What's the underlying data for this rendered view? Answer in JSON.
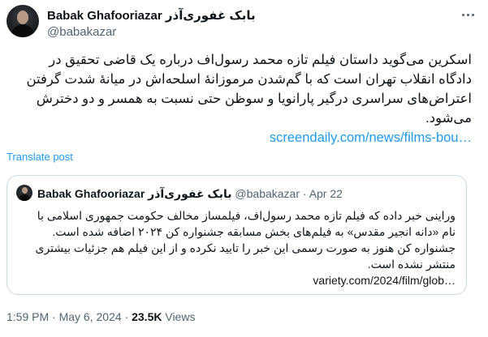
{
  "author": {
    "name": "Babak Ghafooriazar بابک غفوری‌آذر",
    "handle": "@babakazar"
  },
  "tweet": {
    "text": "اسکرین می‌گوید داستان فیلم تازه محمد رسول‌اف درباره یک قاضی تحقیق در دادگاه انقلاب تهران است که با گم‌شدن مرموزانهٔ اسلحه‌اش در میانهٔ شدت گرفتن اعتراض‌های سراسری درگیر پارانویا و سوظن حتی نسبت به همسر و دو دخترش می‌شود.",
    "link": "screendaily.com/news/films-bou…",
    "translate_label": "Translate post"
  },
  "quoted": {
    "name": "Babak Ghafooriazar بابک غفوری‌آذر",
    "handle": "@babakazar",
    "separator": "·",
    "date": "Apr 22",
    "text": "وراینی خبر داده که فیلم تازه محمد رسول‌اف، فیلمساز مخالف حکومت جمهوری اسلامی با نام «دانه انجیر مقدس» به فیلم‌های بخش مسابقه جشنواره کن ۲۰۲۴ اضافه شده است. جشنواره کن هنوز به صورت رسمی این خبر را تایید نکرده و از این فیلم هم جزئیات بیشتری منتشر نشده است.",
    "link": "variety.com/2024/film/glob…"
  },
  "meta": {
    "time": "1:59 PM",
    "date": "May 6, 2024",
    "separator": "·",
    "views_count": "23.5K",
    "views_label": "Views"
  },
  "icons": {
    "more": "more-horizontal-icon"
  }
}
